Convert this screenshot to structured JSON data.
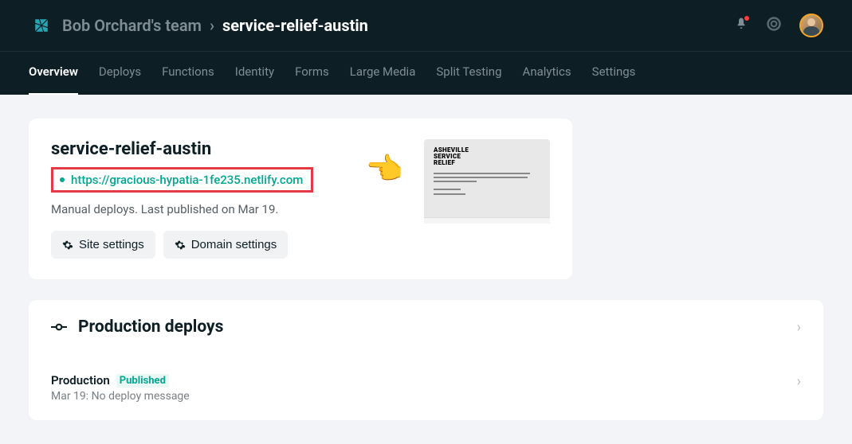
{
  "header": {
    "team_name": "Bob Orchard's team",
    "project_name": "service-relief-austin"
  },
  "tabs": [
    {
      "label": "Overview",
      "active": true
    },
    {
      "label": "Deploys",
      "active": false
    },
    {
      "label": "Functions",
      "active": false
    },
    {
      "label": "Identity",
      "active": false
    },
    {
      "label": "Forms",
      "active": false
    },
    {
      "label": "Large Media",
      "active": false
    },
    {
      "label": "Split Testing",
      "active": false
    },
    {
      "label": "Analytics",
      "active": false
    },
    {
      "label": "Settings",
      "active": false
    }
  ],
  "site": {
    "title": "service-relief-austin",
    "url": "https://gracious-hypatia-1fe235.netlify.com",
    "deploy_info": "Manual deploys. Last published on Mar 19.",
    "preview": {
      "title_l1": "ASHEVILLE",
      "title_l2": "SERVICE",
      "title_l3": "RELIEF"
    },
    "buttons": {
      "site_settings": "Site settings",
      "domain_settings": "Domain settings"
    }
  },
  "production": {
    "section_title": "Production deploys",
    "items": [
      {
        "branch": "Production",
        "badge": "Published",
        "message": "Mar 19: No deploy message"
      }
    ]
  },
  "pointer": "👉"
}
